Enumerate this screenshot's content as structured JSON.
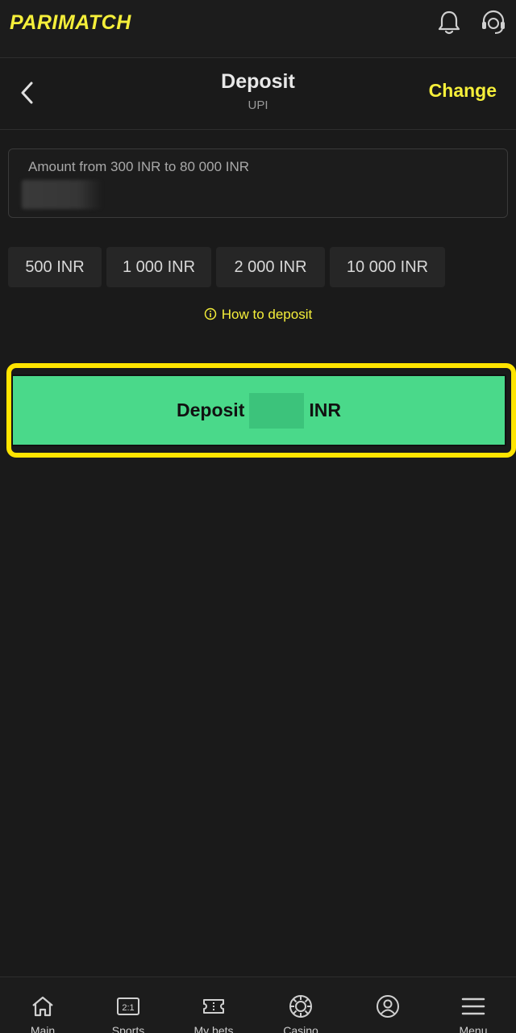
{
  "header": {
    "logo": "PARIMATCH",
    "icons": [
      "bell-icon",
      "support-headset-icon"
    ]
  },
  "subheader": {
    "title": "Deposit",
    "subtitle": "UPI",
    "change_label": "Change",
    "back_icon": "chevron-left-icon"
  },
  "amount": {
    "label": "Amount from 300 INR to 80 000 INR",
    "value": ""
  },
  "quick_amounts": [
    "500 INR",
    "1 000 INR",
    "2 000 INR",
    "10 000 INR"
  ],
  "how_to": {
    "label": "How to deposit",
    "icon": "info-icon"
  },
  "deposit_button": {
    "prefix": "Deposit",
    "suffix": "INR"
  },
  "nav": {
    "items": [
      {
        "label": "Main",
        "icon": "home-icon"
      },
      {
        "label": "Sports",
        "icon": "odds-icon"
      },
      {
        "label": "My bets",
        "icon": "ticket-icon"
      },
      {
        "label": "Casino",
        "icon": "casino-chip-icon"
      },
      {
        "label": "",
        "icon": "profile-icon"
      },
      {
        "label": "Menu",
        "icon": "menu-icon"
      }
    ]
  },
  "colors": {
    "background": "#1a1a1a",
    "accent_yellow": "#f5ef3a",
    "deposit_green": "#4ad98a",
    "highlight_frame": "#ffe400"
  }
}
